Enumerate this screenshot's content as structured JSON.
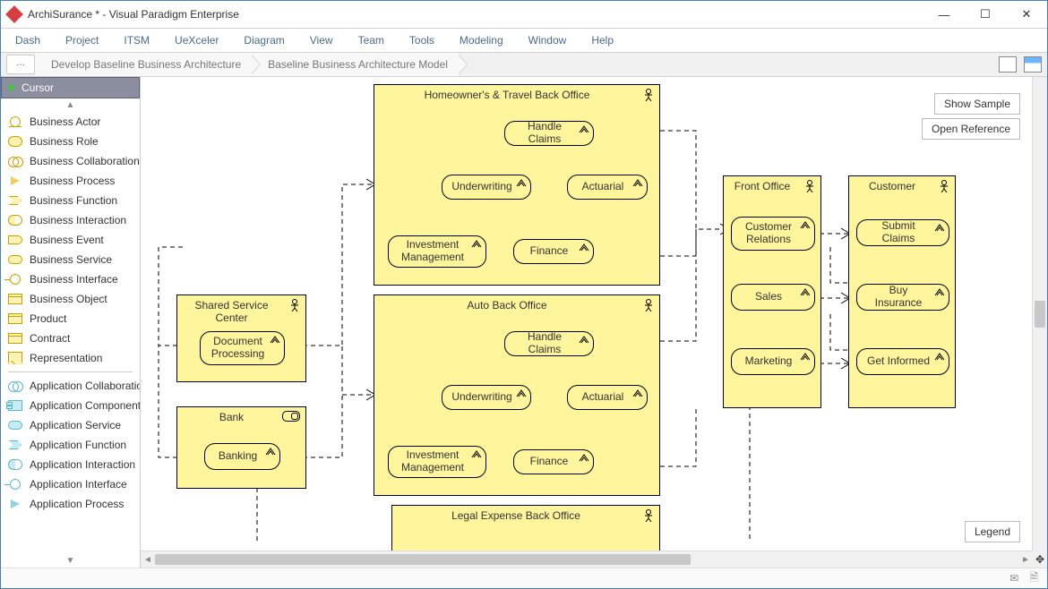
{
  "window": {
    "title": "ArchiSurance * - Visual Paradigm Enterprise"
  },
  "menu": [
    "Dash",
    "Project",
    "ITSM",
    "UeXceler",
    "Diagram",
    "View",
    "Team",
    "Tools",
    "Modeling",
    "Window",
    "Help"
  ],
  "breadcrumb": {
    "more": "...",
    "b1": "Develop Baseline Business Architecture",
    "b2": "Baseline Business Architecture Model"
  },
  "palette": {
    "cursor": "Cursor",
    "items": [
      "Business Actor",
      "Business Role",
      "Business Collaboration",
      "Business Process",
      "Business Function",
      "Business Interaction",
      "Business Event",
      "Business Service",
      "Business Interface",
      "Business Object",
      "Product",
      "Contract",
      "Representation",
      "Application Collaboration",
      "Application Component",
      "Application Service",
      "Application Function",
      "Application Interaction",
      "Application Interface",
      "Application Process"
    ]
  },
  "buttons": {
    "showSample": "Show Sample",
    "openRef": "Open Reference",
    "legend": "Legend"
  },
  "diagram": {
    "groups": {
      "homeowner": "Homeowner's & Travel Back Office",
      "auto": "Auto Back Office",
      "legal": "Legal Expense Back Office",
      "shared": "Shared Service Center",
      "bank": "Bank",
      "front": "Front Office",
      "customer": "Customer"
    },
    "funcs": {
      "handleClaims": "Handle Claims",
      "underwriting": "Underwriting",
      "actuarial": "Actuarial",
      "invMgmt": "Investment\nManagement",
      "finance": "Finance",
      "docProc": "Document\nProcessing",
      "banking": "Banking",
      "custRel": "Customer\nRelations",
      "sales": "Sales",
      "marketing": "Marketing",
      "submit": "Submit Claims",
      "buy": "Buy Insurance",
      "inform": "Get Informed"
    }
  }
}
